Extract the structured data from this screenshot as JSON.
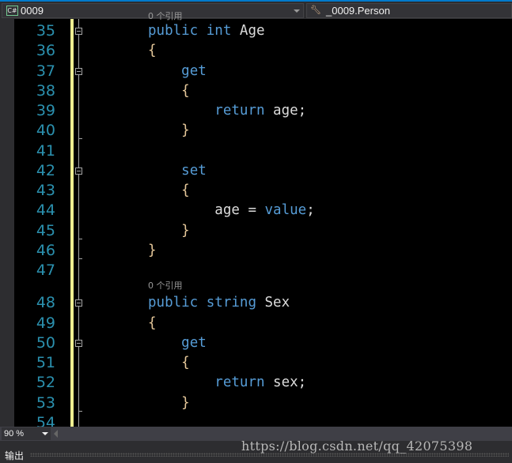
{
  "navbar": {
    "project_combo": {
      "icon": "csharp-file-icon",
      "badge": "C#",
      "value": "0009"
    },
    "member_combo": {
      "icon": "property-icon",
      "value": "_0009.Person"
    }
  },
  "editor": {
    "partial_ref_label": "0 个引用",
    "ref_label": "0 个引用",
    "lines": [
      {
        "n": "35",
        "tokens": [
          [
            "kw",
            "public"
          ],
          [
            "id",
            " "
          ],
          [
            "kw",
            "int"
          ],
          [
            "id",
            " Age"
          ]
        ],
        "indent": 0
      },
      {
        "n": "36",
        "tokens": [
          [
            "br",
            "{"
          ]
        ],
        "indent": 0
      },
      {
        "n": "37",
        "tokens": [
          [
            "kw",
            "get"
          ]
        ],
        "indent": 4
      },
      {
        "n": "38",
        "tokens": [
          [
            "br",
            "{"
          ]
        ],
        "indent": 4
      },
      {
        "n": "39",
        "tokens": [
          [
            "kw",
            "return"
          ],
          [
            "id",
            " age;"
          ]
        ],
        "indent": 8
      },
      {
        "n": "40",
        "tokens": [
          [
            "br",
            "}"
          ]
        ],
        "indent": 4
      },
      {
        "n": "41",
        "tokens": [],
        "indent": 0
      },
      {
        "n": "42",
        "tokens": [
          [
            "kw",
            "set"
          ]
        ],
        "indent": 4
      },
      {
        "n": "43",
        "tokens": [
          [
            "br",
            "{"
          ]
        ],
        "indent": 4
      },
      {
        "n": "44",
        "tokens": [
          [
            "id",
            "age = "
          ],
          [
            "kw",
            "value"
          ],
          [
            "id",
            ";"
          ]
        ],
        "indent": 8
      },
      {
        "n": "45",
        "tokens": [
          [
            "br",
            "}"
          ]
        ],
        "indent": 4
      },
      {
        "n": "46",
        "tokens": [
          [
            "br",
            "}"
          ]
        ],
        "indent": 0
      },
      {
        "n": "47",
        "tokens": [],
        "indent": 0
      },
      {
        "n": "48",
        "tokens": [
          [
            "kw",
            "public"
          ],
          [
            "id",
            " "
          ],
          [
            "kw",
            "string"
          ],
          [
            "id",
            " Sex"
          ]
        ],
        "indent": 0
      },
      {
        "n": "49",
        "tokens": [
          [
            "br",
            "{"
          ]
        ],
        "indent": 0
      },
      {
        "n": "50",
        "tokens": [
          [
            "kw",
            "get"
          ]
        ],
        "indent": 4
      },
      {
        "n": "51",
        "tokens": [
          [
            "br",
            "{"
          ]
        ],
        "indent": 4
      },
      {
        "n": "52",
        "tokens": [
          [
            "kw",
            "return"
          ],
          [
            "id",
            " sex;"
          ]
        ],
        "indent": 8
      },
      {
        "n": "53",
        "tokens": [
          [
            "br",
            "}"
          ]
        ],
        "indent": 4
      },
      {
        "n": "54",
        "tokens": [],
        "indent": 0
      }
    ]
  },
  "statusbar": {
    "zoom_level": "90 %"
  },
  "output_panel": {
    "label": "输出"
  },
  "watermark": "https://blog.csdn.net/qq_42075398",
  "colors": {
    "keyword": "#569cd6",
    "identifier": "#dcdcdc",
    "line_number": "#2b91af",
    "change_bar": "#efef91",
    "accent": "#007acc"
  }
}
